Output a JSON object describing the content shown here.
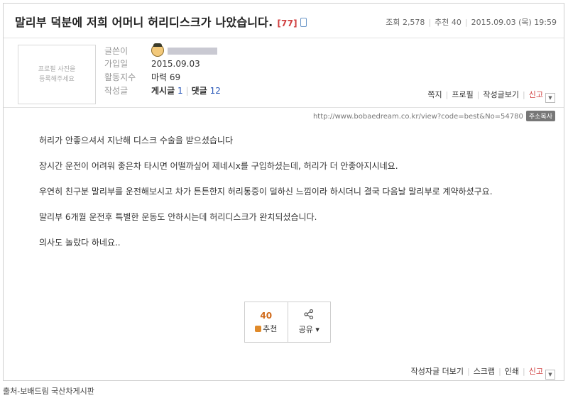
{
  "post": {
    "title": "말리부 덕분에 저희 어머니 허리디스크가 나았습니다.",
    "comment_count": "[77]",
    "stats": {
      "views": "조회 2,578",
      "recommends": "추천 40",
      "date": "2015.09.03 (목) 19:59"
    }
  },
  "profile": {
    "photo_placeholder_line1": "프로필 사진을",
    "photo_placeholder_line2": "등록해주세요",
    "author_label": "글쓴이",
    "joined_label": "가입일",
    "joined_value": "2015.09.03",
    "activity_label": "활동지수",
    "activity_value": "마력 69",
    "writings_label": "작성글",
    "posts_label": "게시글",
    "posts_count": "1",
    "replies_label": "댓글",
    "replies_count": "12"
  },
  "actions": {
    "message": "쪽지",
    "profile": "프로필",
    "author_posts": "작성글보기",
    "report": "신고"
  },
  "url": {
    "text": "http://www.bobaedream.co.kr/view?code=best&No=54780",
    "copy_label": "주소복사"
  },
  "body": [
    "허리가 안좋으셔서 지난해 디스크 수술을 받으셨습니다",
    "장시간 운전이 어려워 좋은차 타시면 어떨까싶어 제네시x를 구입하셨는데, 허리가 더 안좋아지시네요.",
    "우연히 친구분 말리부를 운전해보시고 차가 튼튼한지 허리통증이 덜하신 느낌이라 하시더니 결국 다음날 말리부로 계약하셨구요.",
    "말리부 6개월 운전후 특별한 운동도 안하시는데 허리디스크가 완치되셨습니다.",
    "의사도 놀랐다 하네요.."
  ],
  "vote": {
    "count": "40",
    "recommend_label": "추천",
    "share_label": "공유"
  },
  "bottom": {
    "more_posts": "작성자글 더보기",
    "scrap": "스크랩",
    "print": "인쇄",
    "report": "신고"
  },
  "source": "출처-보배드림 국산차게시판",
  "colors": {
    "accent_red": "#d04040",
    "link_blue": "#2a58b8",
    "vote_orange": "#d06a1a"
  }
}
